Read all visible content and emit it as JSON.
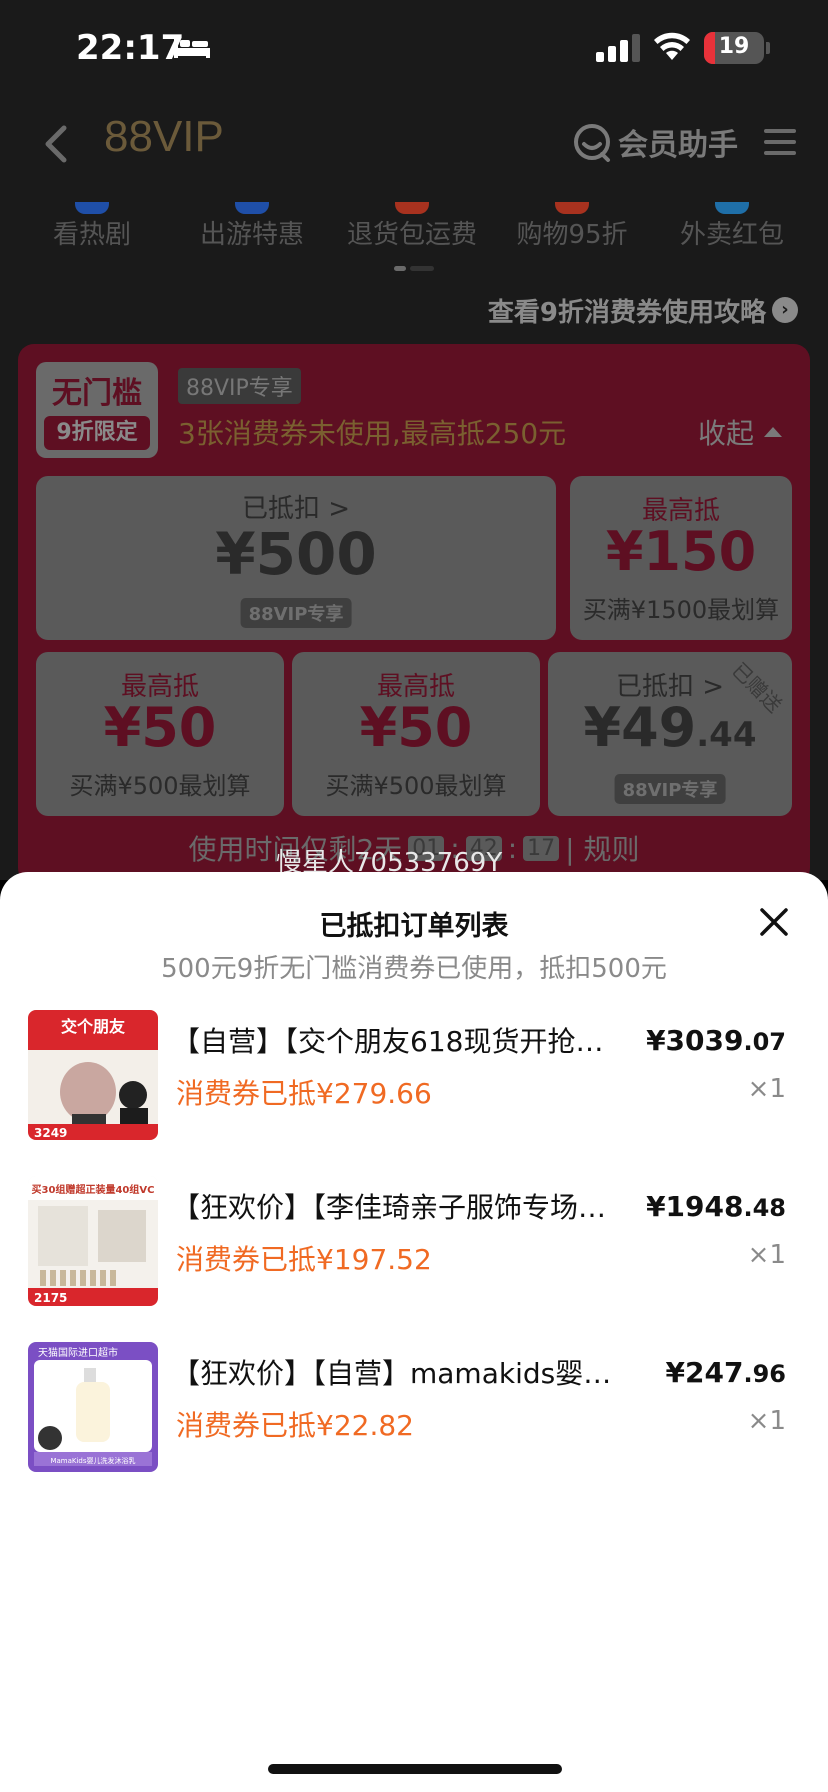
{
  "status_bar": {
    "time": "22:17",
    "battery": "19",
    "battery_level": 0.19,
    "battery_color": "#e8323a"
  },
  "nav": {
    "title": "88VIP",
    "help_label": "会员助手",
    "icons": [
      "back-icon",
      "help-chat-icon",
      "menu-icon"
    ]
  },
  "quick_links": [
    {
      "label": "看热剧",
      "color": "#1f4fa8"
    },
    {
      "label": "出游特惠",
      "color": "#1f4fa8"
    },
    {
      "label": "退货包运费",
      "color": "#a8321f"
    },
    {
      "label": "购物95折",
      "color": "#a8321f"
    },
    {
      "label": "外卖红包",
      "color": "#1f6fa8"
    }
  ],
  "guide_link": "查看9折消费券使用攻略",
  "coupon_panel": {
    "badge_top": "无门槛",
    "badge_bottom": "9折限定",
    "vip_tag": "88VIP专享",
    "summary": "3张消费券未使用,最高抵250元",
    "collapse_label": "收起",
    "coupons": [
      {
        "label": "已抵扣 >",
        "amount": "¥500",
        "sub": "",
        "vip": "88VIP专享",
        "gift": ""
      },
      {
        "label": "最高抵",
        "amount": "¥150",
        "sub": "买满¥1500最划算",
        "vip": "",
        "gift": ""
      },
      {
        "label": "最高抵",
        "amount": "¥50",
        "sub": "买满¥500最划算",
        "vip": "",
        "gift": ""
      },
      {
        "label": "最高抵",
        "amount": "¥50",
        "sub": "买满¥500最划算",
        "vip": "",
        "gift": ""
      },
      {
        "label": "已抵扣 >",
        "amount": "¥49",
        "amount_dec": ".44",
        "sub": "",
        "vip": "88VIP专享",
        "gift": "已赠送"
      }
    ],
    "timer_prefix": "使用时间仅剩2天",
    "timer": [
      "01",
      "42",
      "17"
    ],
    "rules_label": "| 规则"
  },
  "user_tag": "慢星人70533769Y",
  "sheet": {
    "title": "已抵扣订单列表",
    "subtitle": "500元9折无门槛消费券已使用，抵扣500元",
    "orders": [
      {
        "name": "【自营】【交个朋友618现货开抢…",
        "price_int": "¥3039",
        "price_dec": ".07",
        "discount": "消费券已抵¥279.66",
        "qty": "×1"
      },
      {
        "name": "【狂欢价】【李佳琦亲子服饰专场…",
        "price_int": "¥1948",
        "price_dec": ".48",
        "discount": "消费券已抵¥197.52",
        "qty": "×1"
      },
      {
        "name": "【狂欢价】【自营】mamakids婴儿…",
        "price_int": "¥247",
        "price_dec": ".96",
        "discount": "消费券已抵¥22.82",
        "qty": "×1"
      }
    ],
    "thumb_texts": [
      {
        "top": "交个朋友",
        "bottom": "3249"
      },
      {
        "top": "买30组赠超正装量40组VC",
        "bottom": "2175"
      },
      {
        "top": "天猫国际进口超市",
        "bottom": "MamaKids婴儿洗发沐浴乳"
      }
    ]
  }
}
